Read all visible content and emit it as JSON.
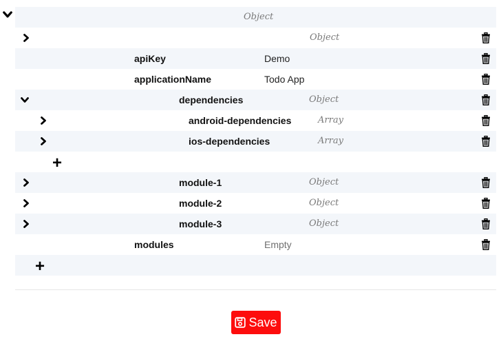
{
  "editor": {
    "root": {
      "type": "Object"
    },
    "object": {
      "type": "Object"
    },
    "rows": {
      "apiKey": {
        "key": "apiKey",
        "value": "Demo"
      },
      "applicationName": {
        "key": "applicationName",
        "value": "Todo App"
      },
      "dependencies": {
        "key": "dependencies",
        "type": "Object"
      },
      "android": {
        "key": "android-dependencies",
        "type": "Array"
      },
      "ios": {
        "key": "ios-dependencies",
        "type": "Array"
      },
      "module1": {
        "key": "module-1",
        "type": "Object"
      },
      "module2": {
        "key": "module-2",
        "type": "Object"
      },
      "module3": {
        "key": "module-3",
        "type": "Object"
      },
      "modules": {
        "key": "modules",
        "value": "Empty"
      }
    },
    "add_icon": "plus-icon"
  },
  "save_button": {
    "label": "Save",
    "icon": "save-icon",
    "color": "#fd0d0d"
  },
  "icons": {
    "delete": "trash-icon",
    "expand": "chevron-right-icon",
    "collapse": "chevron-down-icon"
  }
}
